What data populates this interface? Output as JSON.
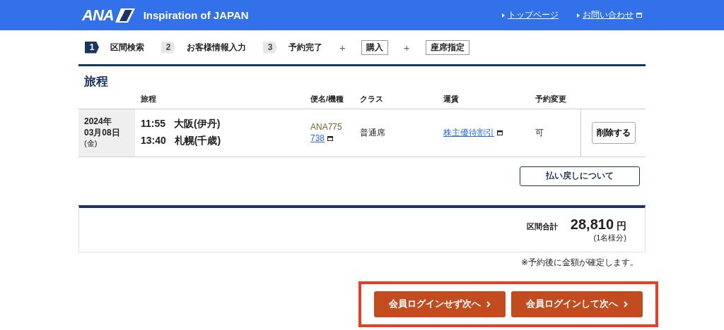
{
  "header": {
    "logo": "ANA",
    "tagline": "Inspiration of JAPAN",
    "links": [
      {
        "label": "トップページ",
        "external": false
      },
      {
        "label": "お問い合わせ",
        "external": true
      }
    ]
  },
  "steps": [
    {
      "kind": "step",
      "number": "1",
      "label": "区間検索",
      "selected": true
    },
    {
      "kind": "step",
      "number": "2",
      "label": "お客様情報入力",
      "selected": false
    },
    {
      "kind": "step",
      "number": "3",
      "label": "予約完了",
      "selected": false
    },
    {
      "kind": "plus",
      "label": "+"
    },
    {
      "kind": "option",
      "label": "購入"
    },
    {
      "kind": "plus",
      "label": "+"
    },
    {
      "kind": "option",
      "label": "座席指定"
    }
  ],
  "itinerary": {
    "title": "旅程",
    "columns": [
      "旅程",
      "便名/機種",
      "クラス",
      "運賃",
      "予約変更"
    ],
    "rows": [
      {
        "date": "2024年\n03月08日",
        "weekday": "(金)",
        "departure_time": "11:55",
        "departure": "大阪(伊丹)",
        "arrival_time": "13:40",
        "arrival": "札幌(千歳)",
        "flight": "ANA775",
        "aircraft": "738",
        "class": "普通席",
        "fare": "株主優待割引",
        "change": "可",
        "action": "削除する"
      }
    ],
    "refund_button": "払い戻しについて"
  },
  "total": {
    "label": "区間合計",
    "amount": "28,810",
    "unit": "円",
    "note": "(1名様分)",
    "footnote": "※予約後に金額が確定します。"
  },
  "actions": [
    {
      "label": "会員ログインせず次へ"
    },
    {
      "label": "会員ログインして次へ"
    }
  ]
}
